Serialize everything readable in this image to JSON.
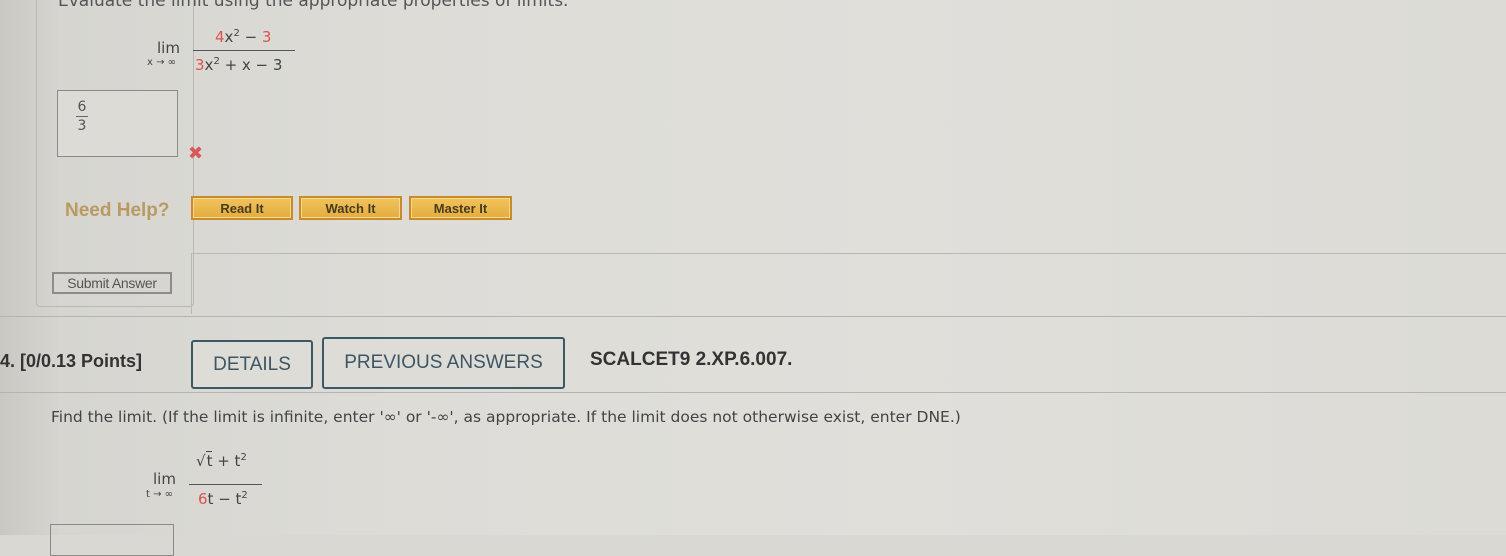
{
  "previous_question": {
    "clipped_instruction": "Evaluate the limit using the appropriate properties of limits.",
    "limit": {
      "word": "lim",
      "subscript": "x → ∞",
      "numerator": {
        "coef": "4",
        "rest": "x",
        "exp": "2",
        "tail_op": " − ",
        "tail_const": "3"
      },
      "denominator": {
        "coef": "3",
        "rest": "x",
        "exp": "2",
        "tail": " + x − 3"
      }
    },
    "answer": {
      "numerator": "6",
      "denominator": "3",
      "status": "incorrect",
      "status_icon": "x-mark-icon",
      "status_glyph": "✖"
    },
    "need_help_label": "Need Help?",
    "help_buttons": [
      {
        "label": "Read It"
      },
      {
        "label": "Watch It"
      },
      {
        "label": "Master It"
      }
    ],
    "submit_label": "Submit Answer"
  },
  "question": {
    "number_label": "4.  [0/0.13 Points]",
    "details_label": "DETAILS",
    "previous_answers_label": "PREVIOUS ANSWERS",
    "code": "SCALCET9 2.XP.6.007.",
    "instructions": "Find the limit. (If the limit is infinite, enter '∞' or '-∞', as appropriate. If the limit does not otherwise exist, enter DNE.)",
    "limit": {
      "word": "lim",
      "subscript": "t → ∞",
      "numerator": {
        "radicand": "t",
        "tail": " + t",
        "exp": "2"
      },
      "denominator": {
        "coef": "6",
        "rest": "t − t",
        "exp": "2"
      }
    }
  },
  "colors": {
    "help_button": "#e9b54a",
    "incorrect": "#d9534f",
    "outline_button": "#3a5866",
    "need_help_text": "#b99a62"
  }
}
